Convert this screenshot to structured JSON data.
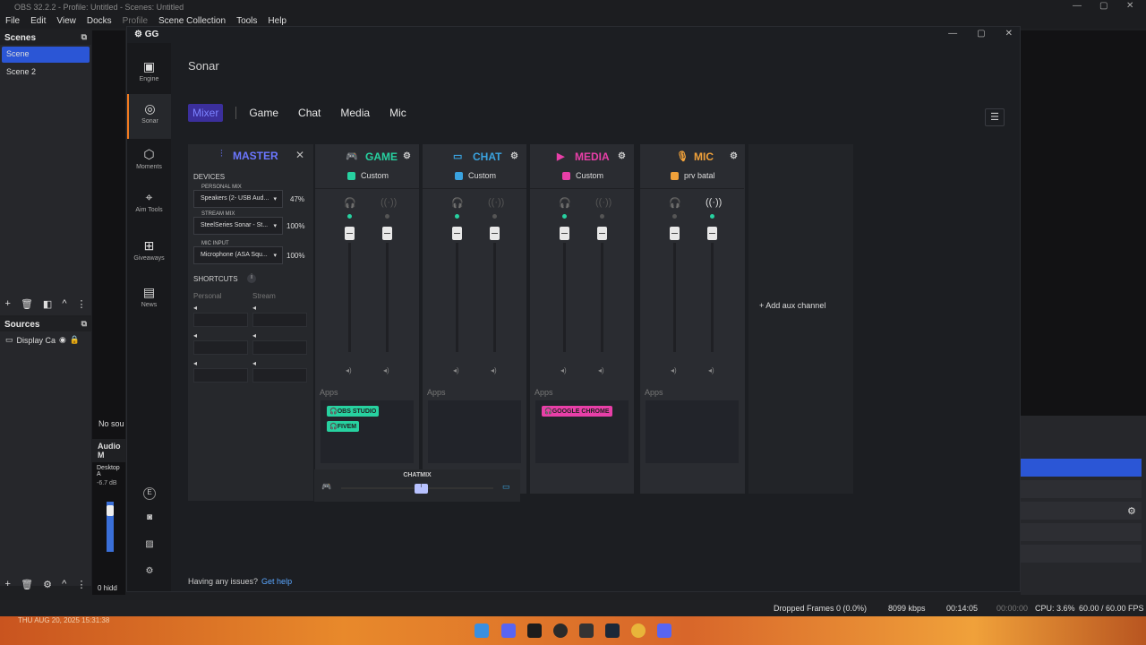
{
  "obs": {
    "title": "OBS 32.2.2 - Profile: Untitled - Scenes: Untitled",
    "menu": [
      "File",
      "Edit",
      "View",
      "Docks",
      "Profile",
      "Scene Collection",
      "Tools",
      "Help"
    ],
    "scenes_title": "Scenes",
    "scenes": [
      "Scene",
      "Scene 2"
    ],
    "sources_title": "Sources",
    "source_item": "Display Ca",
    "no_source": "No sou",
    "audio_title": "Audio M",
    "desktop_audio": "Desktop A",
    "db": "-6.7 dB",
    "hidden": "0 hidd",
    "status": {
      "dropped": "Dropped Frames 0 (0.0%)",
      "kbps": "8099 kbps",
      "rec": "00:14:05",
      "idle": "00:00:00",
      "cpu": "CPU: 3.6%",
      "fps": "60.00 / 60.00 FPS"
    },
    "timestamp": "THU AUG 20, 2025 15:31:38"
  },
  "gg": {
    "logo": "GG",
    "nav": [
      {
        "label": "Engine",
        "icon": "chip-icon"
      },
      {
        "label": "Sonar",
        "icon": "sonar-icon"
      },
      {
        "label": "Moments",
        "icon": "moments-icon"
      },
      {
        "label": "Aim Tools",
        "icon": "crosshair-icon"
      },
      {
        "label": "Giveaways",
        "icon": "gift-icon"
      },
      {
        "label": "News",
        "icon": "news-icon"
      }
    ],
    "nav_bottom_letter": "E",
    "page_title": "Sonar",
    "tabs": {
      "mixer": "Mixer",
      "game": "Game",
      "chat": "Chat",
      "media": "Media",
      "mic": "Mic"
    },
    "master": {
      "title": "MASTER",
      "devices_label": "DEVICES",
      "personal_mix_label": "PERSONAL MIX",
      "personal_mix_device": "Speakers (2- USB Aud...",
      "personal_mix_pct": "47%",
      "stream_mix_label": "STREAM MIX",
      "stream_mix_device": "SteelSeries Sonar - St...",
      "stream_mix_pct": "100%",
      "mic_input_label": "MIC INPUT",
      "mic_input_device": "Microphone (ASA Squ...",
      "mic_input_pct": "100%",
      "shortcuts_label": "SHORTCUTS",
      "personal_col": "Personal",
      "stream_col": "Stream"
    },
    "channels": [
      {
        "name": "GAME",
        "color": "#27d1a0",
        "preset": "Custom",
        "preset_color": "#27d1a0",
        "apps": [
          "OBS STUDIO",
          "FIVEM"
        ]
      },
      {
        "name": "CHAT",
        "color": "#3aa3e0",
        "preset": "Custom",
        "preset_color": "#3aa3e0",
        "apps": []
      },
      {
        "name": "MEDIA",
        "color": "#e83fa8",
        "preset": "Custom",
        "preset_color": "#e83fa8",
        "apps": [
          "GOOGLE CHROME"
        ]
      },
      {
        "name": "MIC",
        "color": "#f0a13a",
        "preset": "prv batal",
        "preset_color": "#f0a13a",
        "apps": []
      }
    ],
    "apps_label": "Apps",
    "add_aux": "Add aux channel",
    "chatmix": "CHATMIX",
    "help_text": "Having any issues?",
    "help_link": "Get help"
  }
}
